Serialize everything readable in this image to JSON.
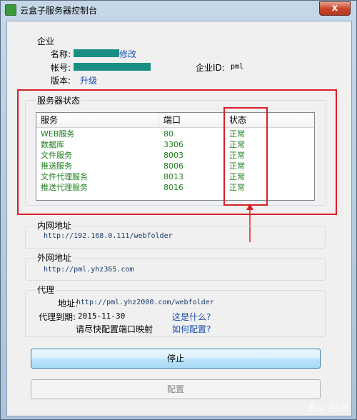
{
  "window": {
    "title": "云盒子服务器控制台",
    "close_glyph": "x"
  },
  "enterprise": {
    "section_label": "企业",
    "name_label": "名称:",
    "edit_link": "修改",
    "account_label": "帐号:",
    "enterprise_id_label": "企业ID:",
    "enterprise_id_value": "pml",
    "version_label": "版本:",
    "upgrade_link": "升级"
  },
  "server_status": {
    "section_label": "服务器状态",
    "columns": [
      "服务",
      "端口",
      "状态"
    ],
    "rows": [
      {
        "service": "WEB服务",
        "port": "80",
        "status": "正常"
      },
      {
        "service": "数据库",
        "port": "3306",
        "status": "正常"
      },
      {
        "service": "文件服务",
        "port": "8003",
        "status": "正常"
      },
      {
        "service": "推送服务",
        "port": "8006",
        "status": "正常"
      },
      {
        "service": "文件代理服务",
        "port": "8013",
        "status": "正常"
      },
      {
        "service": "推送代理服务",
        "port": "8016",
        "status": "正常"
      }
    ]
  },
  "lan_address": {
    "section_label": "内网地址",
    "url": "http://192.168.0.111/webfolder"
  },
  "wan_address": {
    "section_label": "外网地址",
    "url": "http://pml.yhz365.com"
  },
  "proxy": {
    "section_label": "代理",
    "address_label": "地址:",
    "address_url": "http://pml.yhz2000.com/webfolder",
    "expiry_label": "代理到期:",
    "expiry_date": "2015-11-30",
    "what_is_link": "这是什么?",
    "hint_text": "请尽快配置端口映射",
    "how_configure_link": "如何配置?"
  },
  "buttons": {
    "stop": "停止",
    "configure": "配置"
  },
  "watermark": "Bai 经验",
  "colors": {
    "annotation_red": "#d81f26",
    "ok_green": "#1f7f1f",
    "link_blue": "#1a4fb0",
    "redacted": "#1a8f83"
  }
}
